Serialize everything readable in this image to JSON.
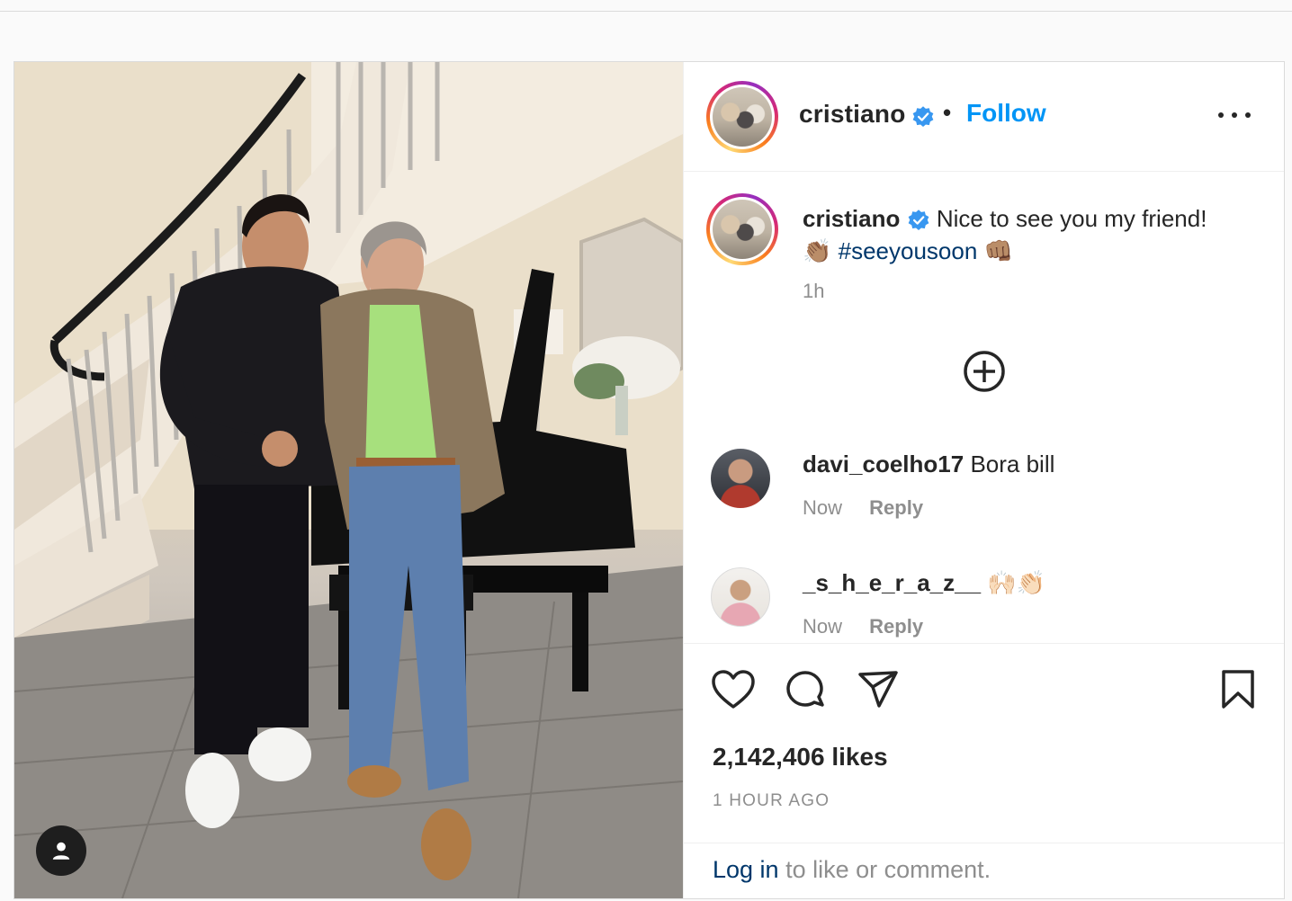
{
  "post": {
    "author": "cristiano",
    "follow_label": "Follow",
    "separator": "•",
    "caption": {
      "username": "cristiano",
      "text_before": "Nice to see you my friend!",
      "emoji_1": "👏🏽",
      "hashtag": "#seeyousoon",
      "emoji_2": "👊🏽",
      "time": "1h"
    },
    "comments": [
      {
        "username": "davi_coelho17",
        "text": "Bora bill",
        "time": "Now",
        "reply_label": "Reply"
      },
      {
        "username": "_s_h_e_r_a_z__",
        "text": "🙌🏻👏🏻",
        "time": "Now",
        "reply_label": "Reply"
      }
    ],
    "likes": "2,142,406 likes",
    "time_ago": "1 HOUR AGO",
    "login": {
      "link": "Log in",
      "rest": "to like or comment."
    }
  },
  "icons": [
    "more-icon",
    "verified-badge-icon",
    "load-more-plus-icon",
    "heart-icon",
    "comment-icon",
    "share-icon",
    "bookmark-icon",
    "user-tag-icon"
  ],
  "colors": {
    "link_blue": "#0095f6",
    "hashtag_blue": "#00376b",
    "muted_gray": "#8e8e8e",
    "verified_blue": "#3897f0"
  }
}
